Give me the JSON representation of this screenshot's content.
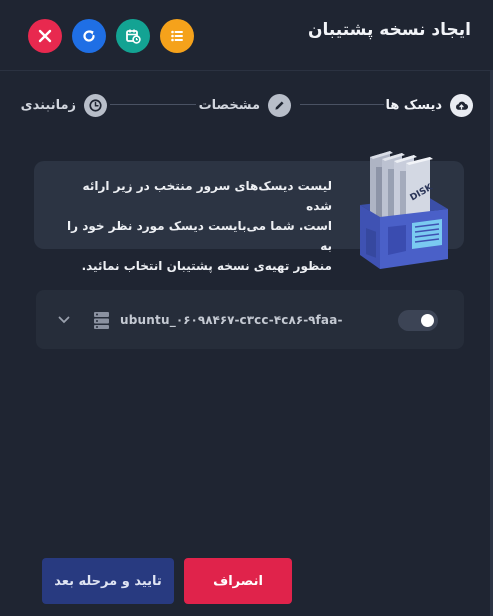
{
  "header": {
    "title": "ایجاد نسخه پشتیبان",
    "buttons": [
      {
        "name": "close-button",
        "icon": "close-icon",
        "color": "#e8294f"
      },
      {
        "name": "refresh-button",
        "icon": "refresh-icon",
        "color": "#1f6fe5"
      },
      {
        "name": "schedule-button",
        "icon": "calendar-clock-icon",
        "color": "#13a393"
      },
      {
        "name": "list-button",
        "icon": "list-icon",
        "color": "#f5a21b"
      }
    ]
  },
  "steps": [
    {
      "label": "دیسک ها",
      "icon": "cloud-upload-icon",
      "active": true
    },
    {
      "label": "مشخصات",
      "icon": "pencil-icon",
      "active": false
    },
    {
      "label": "زمانبندی",
      "icon": "clock-icon",
      "active": false
    }
  ],
  "info": {
    "text": "لیست دیسک‌های سرور منتخب در زیر ارائه شده\nاست. شما می‌بایست دیسک مورد نظر خود را به\nمنظور تهیه‌ی نسخه پشتیبان انتخاب نمائید.",
    "illustration_label": "DISK"
  },
  "disks": [
    {
      "name": "ubuntu_۰۶۰۹۸۴۶۷-c۳cc-۴c۸۶-۹faa-",
      "selected": true
    }
  ],
  "footer": {
    "confirm_label": "تایید و مرحله بعد",
    "cancel_label": "انصراف"
  },
  "colors": {
    "background": "#1f2532",
    "card": "#2c3443",
    "confirm": "#283a80",
    "cancel": "#e0234b"
  }
}
